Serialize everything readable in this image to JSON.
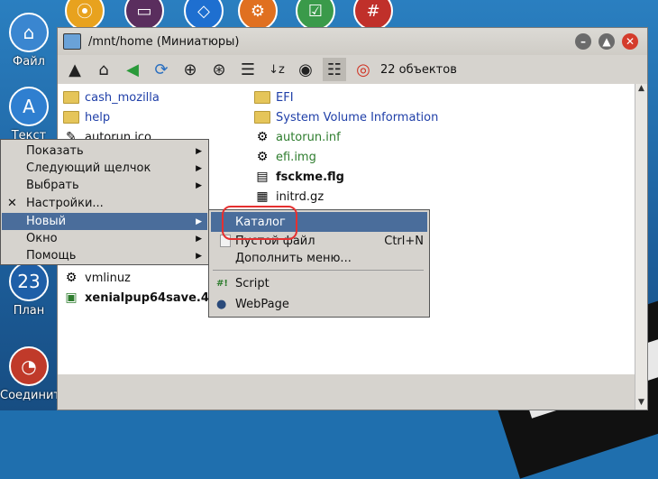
{
  "desktop": {
    "icons": [
      {
        "label": "Файл"
      },
      {
        "label": "Текст"
      },
      {
        "label": "План"
      },
      {
        "label": "Соединить"
      }
    ]
  },
  "window": {
    "title": "/mnt/home (Миниатюры)",
    "item_count": "22 объектов"
  },
  "files": {
    "left": [
      {
        "name": "cash_mozilla"
      },
      {
        "name": "help"
      },
      {
        "name": "autorun.ico"
      },
      {
        "name": "vmlinuz"
      },
      {
        "name": "xenialpup64save.4"
      }
    ],
    "right": [
      {
        "name": "EFI"
      },
      {
        "name": "System Volume Information"
      },
      {
        "name": "autorun.inf"
      },
      {
        "name": "efi.img"
      },
      {
        "name": "fsckme.flg"
      },
      {
        "name": "initrd.gz"
      }
    ]
  },
  "context_menu": {
    "items": [
      {
        "label": "Показать"
      },
      {
        "label": "Следующий щелчок"
      },
      {
        "label": "Выбрать"
      },
      {
        "label": "Настройки..."
      },
      {
        "label": "Новый"
      },
      {
        "label": "Окно"
      },
      {
        "label": "Помощь"
      }
    ]
  },
  "submenu": {
    "items": [
      {
        "label": "Каталог"
      },
      {
        "label": "Пустой файл",
        "shortcut": "Ctrl+N"
      },
      {
        "label": "Дополнить меню..."
      },
      {
        "label": "Script"
      },
      {
        "label": "WebPage"
      }
    ]
  },
  "colors": {
    "highlight": "#4a6d9b",
    "annotation": "#e53030"
  }
}
